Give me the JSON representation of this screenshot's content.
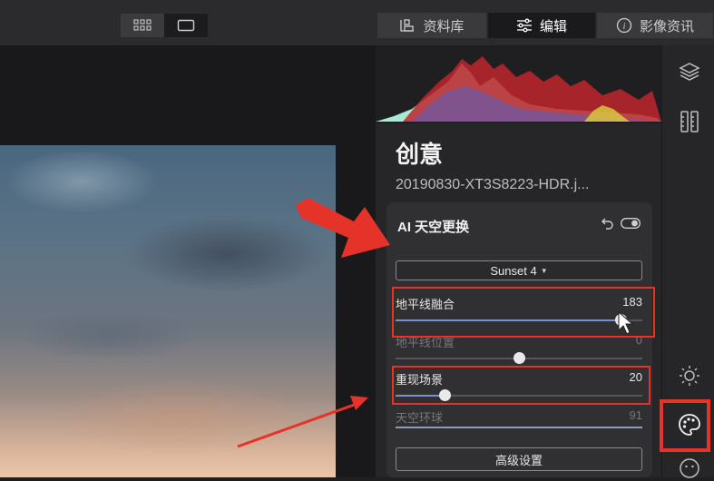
{
  "topbar": {
    "view_modes": [
      {
        "icon": "grid-view-icon",
        "active": false
      },
      {
        "icon": "single-view-icon",
        "active": true
      }
    ],
    "tabs": [
      {
        "label": "资料库",
        "icon": "library-icon",
        "active": false
      },
      {
        "label": "编辑",
        "icon": "sliders-icon",
        "active": true
      },
      {
        "label": "影像资讯",
        "icon": "info-icon",
        "active": false
      }
    ]
  },
  "panel": {
    "title": "创意",
    "filename": "20190830-XT3S8223-HDR.j...",
    "tool": {
      "title": "AI 天空更换",
      "preset": "Sunset 4",
      "sliders": [
        {
          "label": "地平线融合",
          "value": "183",
          "level": 0.91,
          "dim": false
        },
        {
          "label": "地平线位置",
          "value": "0",
          "level": 0.5,
          "dim": true
        },
        {
          "label": "重现场景",
          "value": "20",
          "level": 0.2,
          "dim": false
        },
        {
          "label": "天空环球",
          "value": "91",
          "level": 1.0,
          "dim": true
        }
      ],
      "advanced_button": "高级设置"
    }
  },
  "sidebar": {
    "icons": [
      "layers-icon",
      "ruler-icon",
      "sun-icon",
      "palette-icon",
      "smiley-icon"
    ]
  },
  "colors": {
    "accent_slider": "#7a90c8",
    "annotation_red": "#e5332a"
  }
}
